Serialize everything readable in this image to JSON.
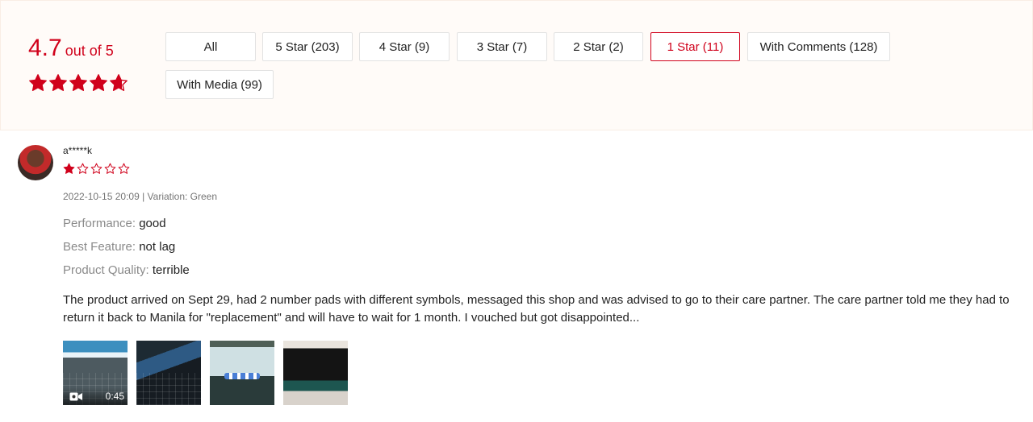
{
  "overview": {
    "rating_value": "4.7",
    "rating_suffix": "out of 5",
    "stars": 4.7,
    "accent_color": "#d0011b",
    "filters": [
      {
        "label": "All",
        "active": false
      },
      {
        "label": "5 Star (203)",
        "active": false
      },
      {
        "label": "4 Star (9)",
        "active": false
      },
      {
        "label": "3 Star (7)",
        "active": false
      },
      {
        "label": "2 Star (2)",
        "active": false
      },
      {
        "label": "1 Star (11)",
        "active": true
      },
      {
        "label": "With Comments (128)",
        "active": false
      },
      {
        "label": "With Media (99)",
        "active": false
      }
    ]
  },
  "review": {
    "username": "a*****k",
    "avatar_icon": "user-avatar",
    "stars": 1,
    "max_stars": 5,
    "meta": "2022-10-15 20:09 | Variation: Green",
    "attributes": [
      {
        "key": "Performance:",
        "value": "good"
      },
      {
        "key": "Best Feature:",
        "value": "not lag"
      },
      {
        "key": "Product Quality:",
        "value": "terrible"
      }
    ],
    "text": "The product arrived on Sept 29, had 2 number pads with different symbols, messaged this shop and was advised to go to their care partner. The care partner told me they had to return it back to Manila for \"replacement\" and will have to wait for 1 month. I vouched but got disappointed...",
    "media": [
      {
        "type": "video",
        "duration": "0:45",
        "icon": "video-camera-icon"
      },
      {
        "type": "image"
      },
      {
        "type": "image"
      },
      {
        "type": "image"
      }
    ]
  }
}
